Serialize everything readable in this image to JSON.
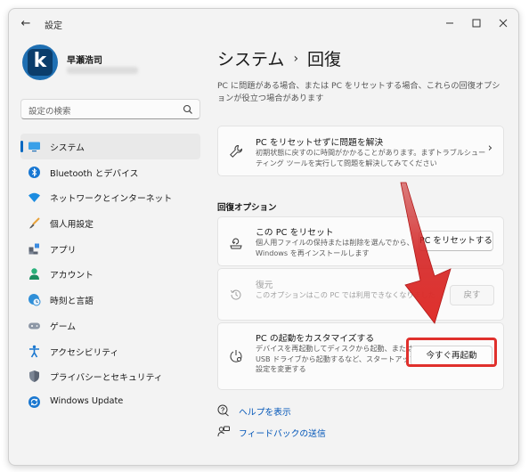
{
  "window": {
    "title": "設定"
  },
  "profile": {
    "name": "早瀬浩司"
  },
  "search": {
    "placeholder": "設定の検索"
  },
  "sidebar": {
    "items": [
      {
        "label": "システム",
        "icon": "monitor-icon",
        "active": true
      },
      {
        "label": "Bluetooth とデバイス",
        "icon": "bluetooth-icon"
      },
      {
        "label": "ネットワークとインターネット",
        "icon": "wifi-icon"
      },
      {
        "label": "個人用設定",
        "icon": "brush-icon"
      },
      {
        "label": "アプリ",
        "icon": "apps-icon"
      },
      {
        "label": "アカウント",
        "icon": "person-icon"
      },
      {
        "label": "時刻と言語",
        "icon": "globe-clock-icon"
      },
      {
        "label": "ゲーム",
        "icon": "gamepad-icon"
      },
      {
        "label": "アクセシビリティ",
        "icon": "accessibility-icon"
      },
      {
        "label": "プライバシーとセキュリティ",
        "icon": "shield-icon"
      },
      {
        "label": "Windows Update",
        "icon": "update-icon"
      }
    ]
  },
  "main": {
    "breadcrumb": [
      "システム",
      "回復"
    ],
    "breadcrumb_sep": "›",
    "intro": "PC に問題がある場合、または PC をリセットする場合、これらの回復オプションが役立つ場合があります",
    "troubleshoot": {
      "title": "PC をリセットせずに問題を解決",
      "desc": "初期状態に戻すのに時間がかかることがあります。まずトラブルシューティング ツールを実行して問題を解決してみてください"
    },
    "section_label": "回復オプション",
    "options": [
      {
        "title": "この PC をリセット",
        "desc": "個人用ファイルの保持または削除を選んでから、Windows を再インストールします",
        "button": "PC をリセットする",
        "disabled": false
      },
      {
        "title": "復元",
        "desc": "このオプションはこの PC では利用できなくなりました",
        "button": "戻す",
        "disabled": true
      },
      {
        "title": "PC の起動をカスタマイズする",
        "desc": "デバイスを再起動してディスクから起動、または USB ドライブから起動するなど、スタートアップ設定を変更する",
        "button": "今すぐ再起動",
        "disabled": false
      }
    ],
    "links": [
      {
        "label": "ヘルプを表示",
        "icon": "help-icon"
      },
      {
        "label": "フィードバックの送信",
        "icon": "feedback-icon"
      }
    ]
  },
  "colors": {
    "accent": "#0067c0",
    "highlight": "#e0302c",
    "link": "#0055b8"
  }
}
